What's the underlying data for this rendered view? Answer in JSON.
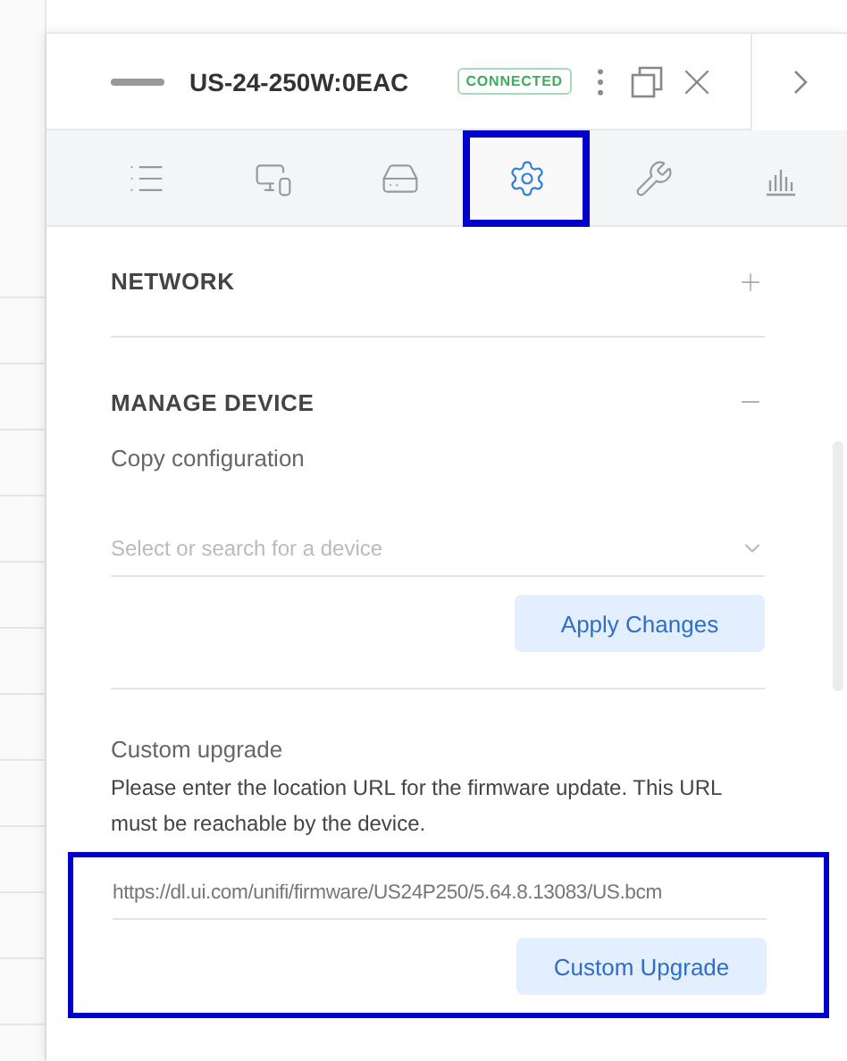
{
  "header": {
    "device_name": "US-24-250W:0EAC",
    "status": "CONNECTED"
  },
  "tabs": [
    {
      "kind": "list",
      "selected": false,
      "highlighted": false
    },
    {
      "kind": "devices",
      "selected": false,
      "highlighted": false
    },
    {
      "kind": "drive",
      "selected": false,
      "highlighted": false
    },
    {
      "kind": "settings",
      "selected": true,
      "highlighted": true
    },
    {
      "kind": "tools",
      "selected": false,
      "highlighted": false
    },
    {
      "kind": "stats",
      "selected": false,
      "highlighted": false
    }
  ],
  "sections": [
    {
      "title": "NETWORK",
      "expanded": false
    },
    {
      "title": "MANAGE DEVICE",
      "expanded": true
    }
  ],
  "manage_device": {
    "copy_label": "Copy configuration",
    "device_select": {
      "placeholder": "Select or search for a device"
    },
    "apply_button": "Apply Changes",
    "custom_upgrade": {
      "label": "Custom upgrade",
      "description": "Please enter the location URL for the firmware update. This URL must be reachable by the device.",
      "url": "https://dl.ui.com/unifi/firmware/US24P250/5.64.8.13083/US.bcm",
      "button": "Custom Upgrade",
      "highlighted": true
    }
  }
}
